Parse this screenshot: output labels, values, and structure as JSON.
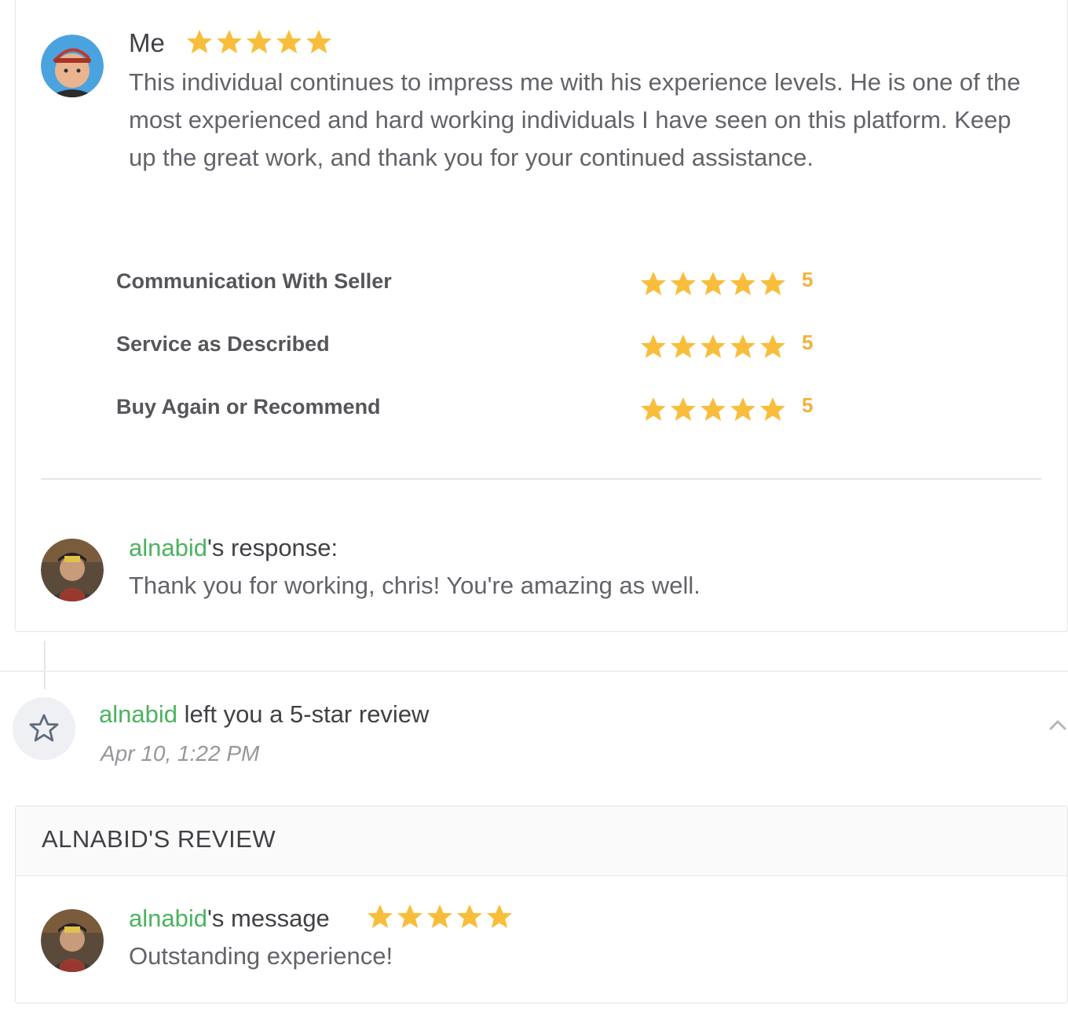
{
  "review_card": {
    "author": "Me",
    "overall_rating": 5,
    "text": "This individual continues to impress me with his experience levels. He is one of the most experienced and hard working individuals I have seen on this platform. Keep up the great work, and thank you for your continued assistance.",
    "breakdown": [
      {
        "label": "Communication With Seller",
        "rating": 5,
        "value": "5"
      },
      {
        "label": "Service as Described",
        "rating": 5,
        "value": "5"
      },
      {
        "label": "Buy Again or Recommend",
        "rating": 5,
        "value": "5"
      }
    ],
    "response": {
      "username": "alnabid",
      "suffix": "'s response:",
      "text": "Thank you for working, chris! You're amazing as well."
    }
  },
  "activity": {
    "username": "alnabid",
    "action": " left you a 5-star review",
    "timestamp": "Apr 10, 1:22 PM",
    "icon": "star-outline-icon",
    "toggle_icon": "chevron-up-icon"
  },
  "seller_review": {
    "header": "ALNABID'S REVIEW",
    "username": "alnabid",
    "suffix": "'s message",
    "rating": 5,
    "text": "Outstanding experience!"
  },
  "colors": {
    "accent_green": "#4bb35f",
    "star_yellow": "#f8be3b",
    "text_dark": "#404145",
    "text_body": "#62646a"
  }
}
